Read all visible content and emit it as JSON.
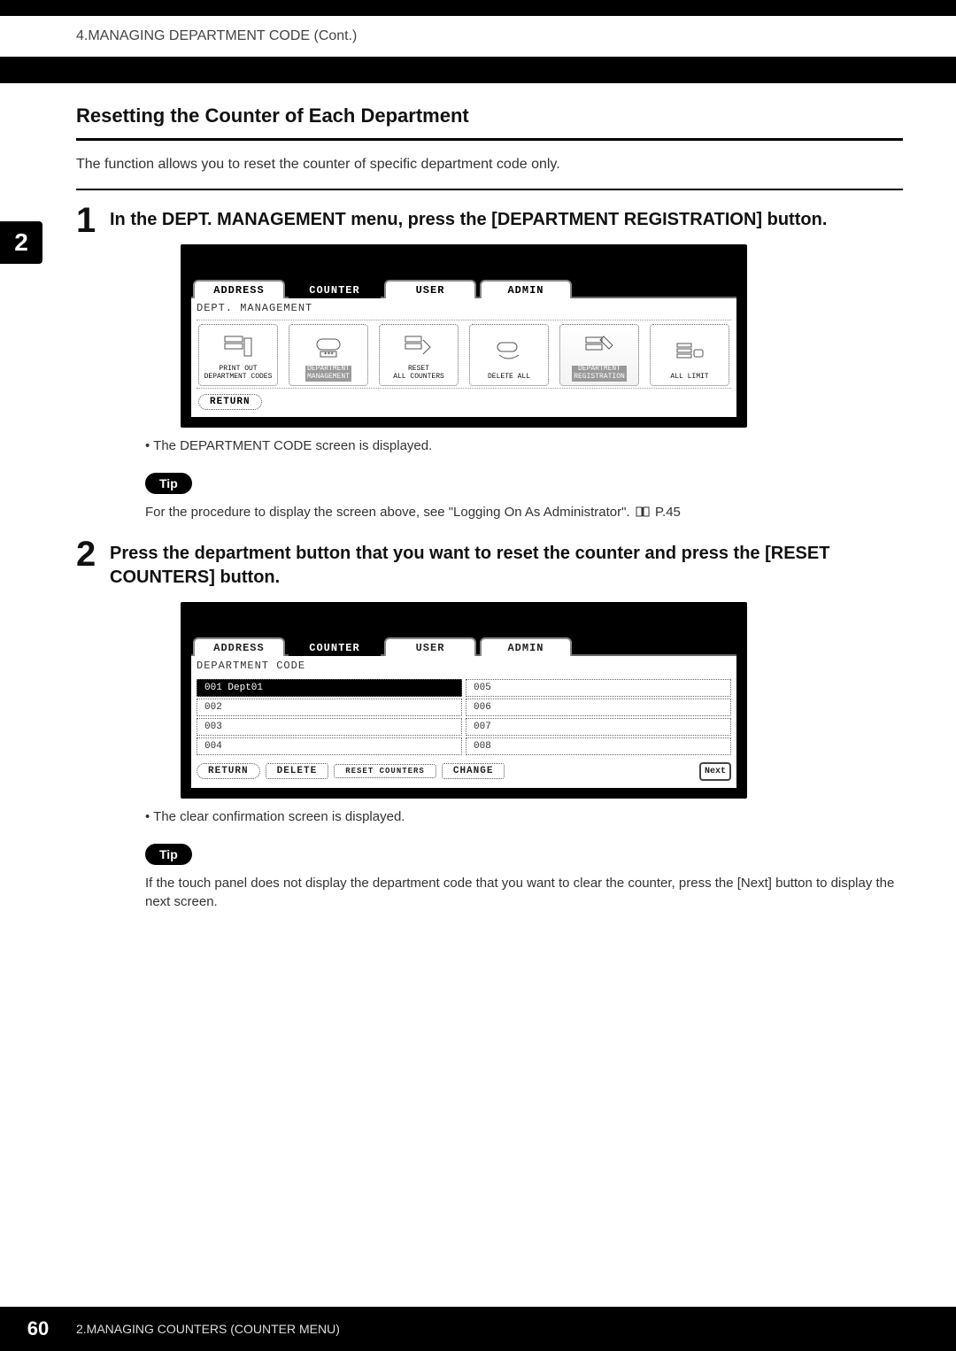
{
  "header": {
    "breadcrumb": "4.MANAGING DEPARTMENT CODE (Cont.)"
  },
  "sidebar": {
    "chapter": "2"
  },
  "section": {
    "title": "Resetting the Counter of Each Department",
    "intro": "The function allows you to reset the counter of specific department code only."
  },
  "step1": {
    "num": "1",
    "heading": "In the DEPT. MANAGEMENT menu, press the [DEPARTMENT REGISTRATION] button.",
    "tabs": {
      "address": "ADDRESS",
      "counter": "COUNTER",
      "user": "USER",
      "admin": "ADMIN"
    },
    "panel_title": "DEPT. MANAGEMENT",
    "icons": {
      "printout": "PRINT OUT\nDEPARTMENT CODES",
      "deptmgmt": "DEPARTMENT\nMANAGEMENT",
      "resetall": "RESET\nALL COUNTERS",
      "deleteall": "DELETE ALL",
      "deptreg": "DEPARTMENT\nREGISTRATION",
      "alllimit": "ALL LIMIT",
      "stars": "***"
    },
    "return_btn": "RETURN",
    "bullet": "The DEPARTMENT CODE screen is displayed.",
    "tip_label": "Tip",
    "tip_text_a": "For the procedure to display the screen above, see \"Logging On As Administrator\".  ",
    "tip_text_b": " P.45"
  },
  "step2": {
    "num": "2",
    "heading": "Press the department button that you want to reset the counter and press the [RESET COUNTERS] button.",
    "tabs": {
      "address": "ADDRESS",
      "counter": "COUNTER",
      "user": "USER",
      "admin": "ADMIN"
    },
    "panel_title": "DEPARTMENT CODE",
    "cells": {
      "c001": "001 Dept01",
      "c005": "005",
      "c002": "002",
      "c006": "006",
      "c003": "003",
      "c007": "007",
      "c004": "004",
      "c008": "008"
    },
    "controls": {
      "return": "RETURN",
      "delete": "DELETE",
      "reset": "RESET COUNTERS",
      "change": "CHANGE",
      "next": "Next"
    },
    "bullet": "The clear confirmation screen is displayed.",
    "tip_label": "Tip",
    "tip_text": "If the touch panel does not display the department code that you want to clear the counter, press the [Next] button to display the next screen."
  },
  "footer": {
    "page": "60",
    "text": "2.MANAGING COUNTERS (COUNTER MENU)"
  }
}
